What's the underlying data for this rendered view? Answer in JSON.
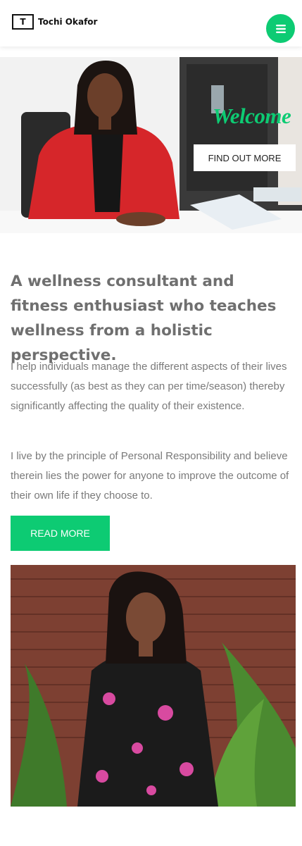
{
  "header": {
    "logo_letter": "T",
    "site_name": "Tochi Okafor",
    "menu_icon": "hamburger-icon"
  },
  "hero": {
    "welcome": "Welcome",
    "cta_label": "FIND OUT MORE"
  },
  "about": {
    "headline": "A wellness consultant and fitness enthusiast who teaches wellness from a holistic perspective.",
    "paragraph_1": "I help individuals manage the different aspects of their lives successfully (as best as they can per time/season) thereby significantly affecting the quality of their existence.",
    "paragraph_2": "I live by the principle of Personal Responsibility and believe therein lies the power for anyone to improve the outcome of their own life if they choose to.",
    "read_more_label": "READ MORE"
  },
  "colors": {
    "accent": "#0dcb73",
    "text": "#6f6f6f"
  }
}
